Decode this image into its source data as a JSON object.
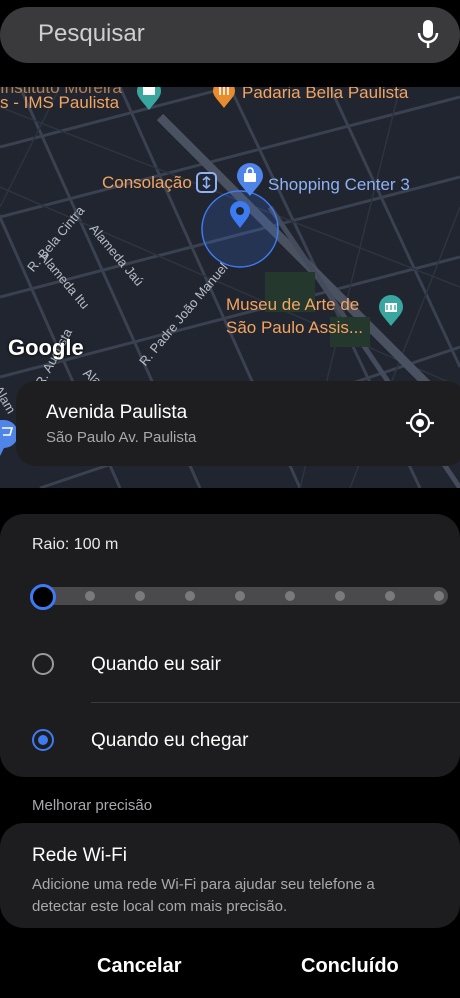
{
  "search": {
    "placeholder": "Pesquisar",
    "mic_icon": "microphone-icon"
  },
  "map": {
    "labels": {
      "ims_top": "Instituto Moreira",
      "ims": "s - IMS Paulista",
      "padaria": "Padaria Bella Paulista",
      "consolacao": "Consolação",
      "shopping": "Shopping Center 3",
      "museu_1": "Museu de Arte de",
      "museu_2": "São Paulo Assis...",
      "bela_cintra": "R. Bela Cintra",
      "itu": "Alameda Itu",
      "jau": "Alameda Jaú",
      "joao_manuel": "R. Padre João Manuel",
      "augusta": "R. Augusta",
      "alam1": "Alam",
      "alam2": "Alar"
    },
    "attribution": "Google"
  },
  "location": {
    "title": "Avenida Paulista",
    "subtitle": "São Paulo Av. Paulista",
    "target_icon": "my-location-icon"
  },
  "radius": {
    "label": "Raio: 100 m",
    "slider_steps": 9,
    "slider_value_step": 0
  },
  "options": [
    {
      "label": "Quando eu sair",
      "selected": false
    },
    {
      "label": "Quando eu chegar",
      "selected": true
    }
  ],
  "precision": {
    "section_label": "Melhorar precisão",
    "wifi_title": "Rede Wi-Fi",
    "wifi_desc": "Adicione uma rede Wi-Fi para ajudar seu telefone a detectar este local com mais precisão."
  },
  "footer": {
    "cancel": "Cancelar",
    "done": "Concluído"
  },
  "colors": {
    "accent": "#3d7bf2",
    "poi_orange": "#f4a460",
    "poi_blue": "#8fb2f4"
  }
}
